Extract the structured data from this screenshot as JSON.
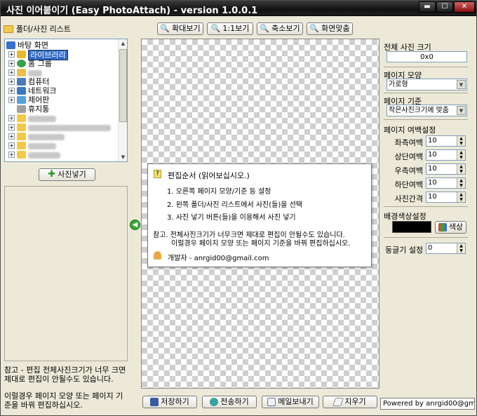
{
  "window": {
    "title": "사진 이어붙이기 (Easy PhotoAttach) - version 1.0.0.1",
    "minimize_glyph": "▬",
    "maximize_glyph": "☐",
    "close_glyph": "✕"
  },
  "left": {
    "folder_label": "폴더/사진 리스트",
    "tree": [
      {
        "label": "바탕 화면",
        "icon": "desktop-icon",
        "color": "#3a6ec8"
      },
      {
        "label": "라이브러리",
        "icon": "library-icon",
        "color": "#e8b830",
        "selected": true
      },
      {
        "label": "홈 그룹",
        "icon": "homegroup-icon",
        "color": "#3aa04a"
      },
      {
        "label": "",
        "icon": "user-folder-icon",
        "color": "#e8c050"
      },
      {
        "label": "컴퓨터",
        "icon": "computer-icon",
        "color": "#4a7ab8"
      },
      {
        "label": "네트워크",
        "icon": "network-icon",
        "color": "#3a78c0"
      },
      {
        "label": "제어판",
        "icon": "control-panel-icon",
        "color": "#58a0d8"
      },
      {
        "label": "휴지통",
        "icon": "recycle-bin-icon",
        "color": "#a0a0a0"
      },
      {
        "label": "",
        "icon": "folder-icon",
        "color": "#f2c94c"
      },
      {
        "label": "",
        "icon": "folder-icon",
        "color": "#f2c94c"
      },
      {
        "label": "",
        "icon": "folder-icon",
        "color": "#f2c94c"
      },
      {
        "label": "",
        "icon": "folder-icon",
        "color": "#f2c94c"
      },
      {
        "label": "",
        "icon": "folder-icon",
        "color": "#f2c94c"
      }
    ],
    "add_photo_button": "사진넣기",
    "note1": "참고 - 편집 전체사진크기가 너무 크면 제대로 편집이 안될수도 있습니다.",
    "note2": "이럴경우 페이지 모양 또는 페이지 기준을 바꿔 편집하십시오."
  },
  "toolbar": {
    "zoom_in": "확대보기",
    "actual_size": "1:1보기",
    "zoom_out": "축소보기",
    "fit_screen": "화면맞춤"
  },
  "popup": {
    "title": "편집순서 (읽어보십시오.)",
    "step1": "1. 오른쪽 페이지 모양/기준 등 설정",
    "step2": "2. 왼쪽 폴더/사진 리스트에서 사진(들)을 선택",
    "step3": "3. 사진 넣기 버튼(들)을 이용해서 사진 넣기",
    "note1": "참고. 전체사진크기가 너무크면 제대로 편집이 안될수도 있습니다.",
    "note2": "이럴경우 페이지 모양 또는 페이지 기준을 바꿔 편집하십시오.",
    "developer": "개발자 - anrgid00@gmail.com"
  },
  "bottom": {
    "save": "저장하기",
    "send": "전송하기",
    "email": "메일보내기",
    "erase": "지우기",
    "powered": "Powered by anrgid00@gmail.com"
  },
  "right": {
    "total_size_label": "전체 사진 크기",
    "total_size_value": "0x0",
    "page_shape_label": "페이지 모양",
    "page_shape_value": "가로형",
    "page_basis_label": "페이지 기준",
    "page_basis_value": "작은사진크기에 맞춤",
    "margin_label": "페이지 여백설정",
    "margins": [
      {
        "label": "좌측여백",
        "value": "10"
      },
      {
        "label": "상단여백",
        "value": "10"
      },
      {
        "label": "우측여백",
        "value": "10"
      },
      {
        "label": "하단여백",
        "value": "10"
      },
      {
        "label": "사진간격",
        "value": "10"
      }
    ],
    "bg_color_label": "배경색상설정",
    "bg_color_value": "#000000",
    "color_button": "색상",
    "round_label": "둥글기 설정",
    "round_value": "0"
  }
}
